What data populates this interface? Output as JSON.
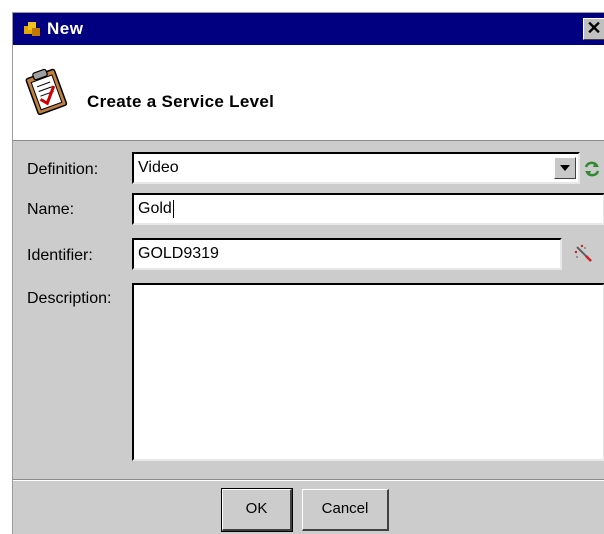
{
  "window": {
    "title": "New",
    "close_glyph": "✕"
  },
  "banner": {
    "heading": "Create a Service Level",
    "icon": "clipboard-checklist-icon"
  },
  "form": {
    "definition": {
      "label": "Definition:",
      "value": "Video",
      "refresh_icon": "refresh-icon"
    },
    "name": {
      "label": "Name:",
      "value": "Gold"
    },
    "identifier": {
      "label": "Identifier:",
      "value": "GOLD9319",
      "generate_icon": "magic-wand-icon"
    },
    "description": {
      "label": "Description:",
      "value": ""
    }
  },
  "buttons": {
    "ok": "OK",
    "cancel": "Cancel"
  },
  "colors": {
    "titlebar": "#000080",
    "dialog_bg": "#cccccc",
    "refresh_icon": "#2e8b2e"
  }
}
